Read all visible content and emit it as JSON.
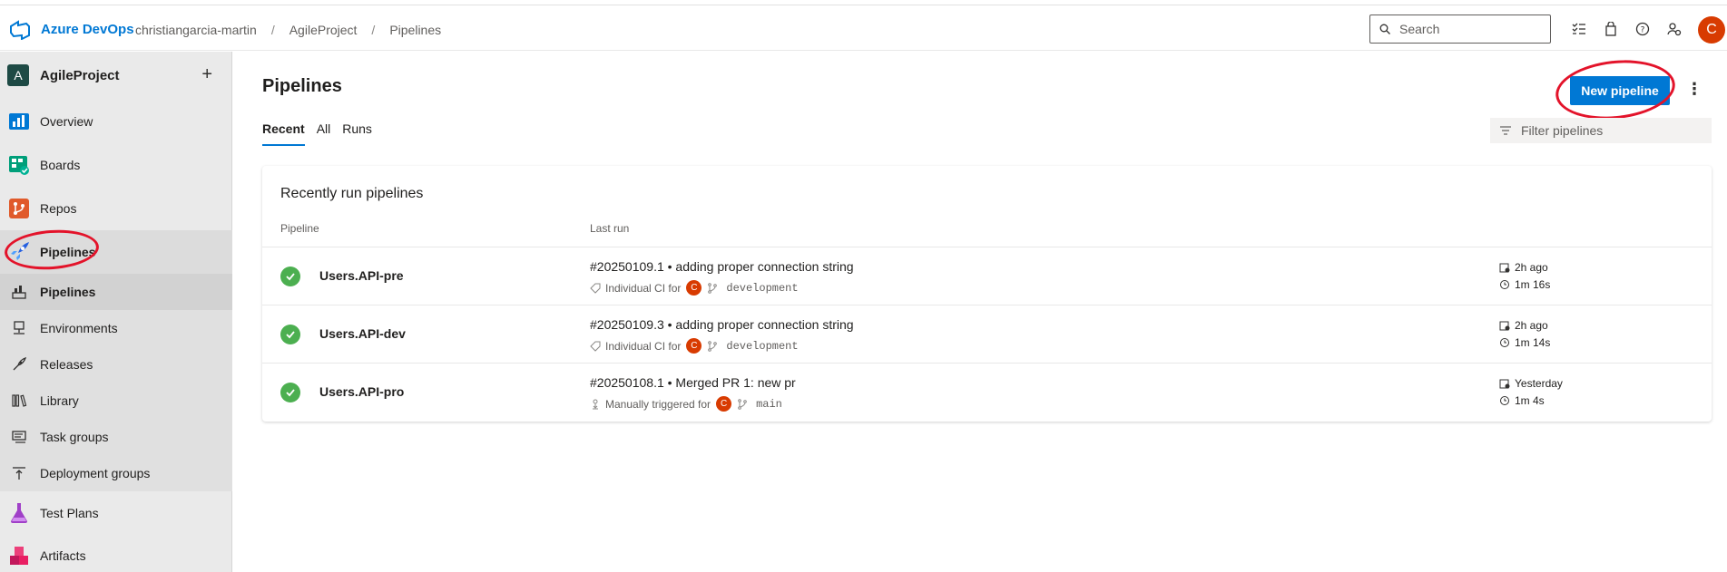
{
  "header": {
    "brand": "Azure DevOps",
    "breadcrumbs": [
      "christiangarcia-martin",
      "AgileProject",
      "Pipelines"
    ],
    "search_placeholder": "Search",
    "avatar_initial": "C"
  },
  "sidebar": {
    "project_initial": "A",
    "project_name": "AgileProject",
    "add_symbol": "+",
    "main_items": [
      {
        "label": "Overview",
        "icon": "overview-icon"
      },
      {
        "label": "Boards",
        "icon": "boards-icon"
      },
      {
        "label": "Repos",
        "icon": "repos-icon"
      },
      {
        "label": "Pipelines",
        "icon": "pipelines-icon"
      }
    ],
    "sub_items": [
      {
        "label": "Pipelines",
        "icon": "pipelines-sub-icon"
      },
      {
        "label": "Environments",
        "icon": "environments-icon"
      },
      {
        "label": "Releases",
        "icon": "releases-icon"
      },
      {
        "label": "Library",
        "icon": "library-icon"
      },
      {
        "label": "Task groups",
        "icon": "task-groups-icon"
      },
      {
        "label": "Deployment groups",
        "icon": "deployment-groups-icon"
      }
    ],
    "bottom_items": [
      {
        "label": "Test Plans",
        "icon": "test-plans-icon"
      },
      {
        "label": "Artifacts",
        "icon": "artifacts-icon"
      }
    ]
  },
  "main": {
    "title": "Pipelines",
    "new_button": "New pipeline",
    "more_symbol": "⋮",
    "tabs": [
      "Recent",
      "All",
      "Runs"
    ],
    "active_tab": "Recent",
    "filter_placeholder": "Filter pipelines",
    "card": {
      "title": "Recently run pipelines",
      "col_pipeline": "Pipeline",
      "col_lastrun": "Last run",
      "rows": [
        {
          "name": "Users.API-pre",
          "run": "#20250109.1 • adding proper connection string",
          "trigger": "Individual CI for",
          "user": "C",
          "branch": "development",
          "when": "2h ago",
          "duration": "1m 16s"
        },
        {
          "name": "Users.API-dev",
          "run": "#20250109.3 • adding proper connection string",
          "trigger": "Individual CI for",
          "user": "C",
          "branch": "development",
          "when": "2h ago",
          "duration": "1m 14s"
        },
        {
          "name": "Users.API-pro",
          "run": "#20250108.1 • Merged PR 1: new pr",
          "trigger": "Manually triggered for",
          "user": "C",
          "branch": "main",
          "when": "Yesterday",
          "duration": "1m 4s"
        }
      ]
    }
  },
  "colors": {
    "accent": "#0078d4",
    "success": "#4caf50",
    "avatar": "#d83b01",
    "annotation": "#e3132a"
  }
}
